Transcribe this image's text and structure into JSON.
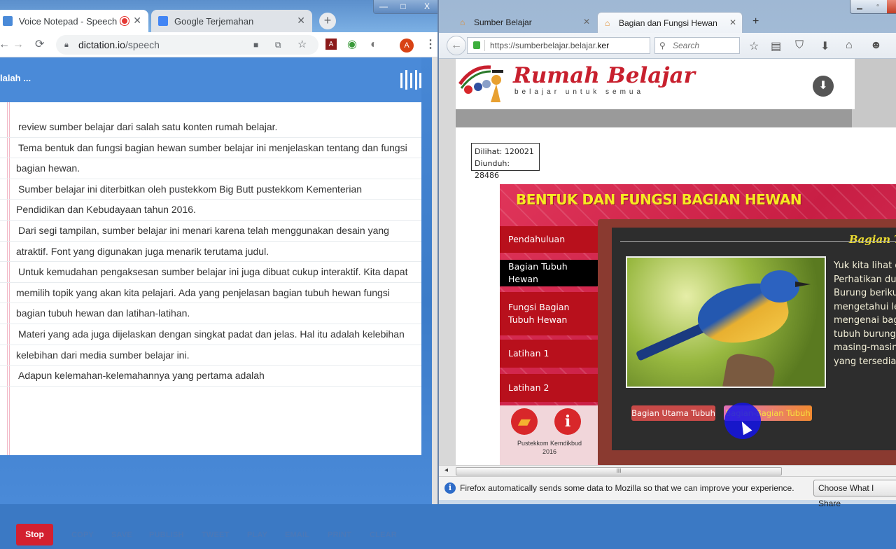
{
  "chrome": {
    "tabs": [
      {
        "label": "Voice Notepad - Speech to",
        "active": true,
        "recording": true
      },
      {
        "label": "Google Terjemahan",
        "active": false
      }
    ],
    "new_tab_label": "+",
    "window_controls": {
      "minimize": "—",
      "maximize": "□",
      "close": "X"
    },
    "address": {
      "domain": "dictation.io",
      "path": "/speech"
    },
    "profile_initial": "A",
    "icons": [
      "back-icon",
      "forward-icon",
      "reload-icon",
      "lock-icon",
      "camera-icon",
      "translate-icon",
      "star-icon",
      "pdf-extension-icon",
      "globe-extension-icon",
      "circle-extension-icon",
      "menu-icon"
    ]
  },
  "dictation": {
    "header_text": "lalah ...",
    "lines": [
      {
        "text": "review sumber belajar dari salah satu konten rumah belajar.",
        "indent": true
      },
      {
        "text": "Tema bentuk dan fungsi bagian hewan sumber belajar ini menjelaskan tentang dan fungsi",
        "indent": true
      },
      {
        "text": "bagian hewan.",
        "indent": false
      },
      {
        "text": "Sumber belajar ini diterbitkan oleh pustekkom Big Butt pustekkom Kementerian",
        "indent": true
      },
      {
        "text": "Pendidikan dan Kebudayaan tahun 2016.",
        "indent": false
      },
      {
        "text": "Dari segi tampilan,  sumber belajar ini menari karena telah menggunakan desain yang",
        "indent": true
      },
      {
        "text": "atraktif.  Font yang digunakan juga menarik terutama judul.",
        "indent": false
      },
      {
        "text": "Untuk kemudahan pengaksesan sumber belajar ini juga dibuat cukup interaktif.  Kita dapat",
        "indent": true
      },
      {
        "text": "memilih topik yang akan kita pelajari.  Ada yang penjelasan bagian tubuh hewan fungsi",
        "indent": false
      },
      {
        "text": "bagian tubuh hewan dan latihan-latihan.",
        "indent": false
      },
      {
        "text": "Materi yang ada juga dijelaskan dengan singkat padat dan jelas.  Hal itu adalah kelebihan",
        "indent": true
      },
      {
        "text": "kelebihan dari media sumber belajar ini.",
        "indent": false
      },
      {
        "text": "Adapun kelemahan-kelemahannya yang pertama adalah",
        "indent": true
      }
    ],
    "stop_label": "Stop",
    "actions": [
      "COPY",
      "SAVE",
      "PUBLISH",
      "TWEET",
      "PLAY",
      "EMAIL",
      "PRINT",
      "CLEAR"
    ],
    "accent_color": "#4a8ad8",
    "stop_color": "#d32030"
  },
  "firefox": {
    "tabs": [
      {
        "label": "Sumber Belajar",
        "active": false
      },
      {
        "label": "Bagian dan Fungsi Hewan",
        "active": true
      }
    ],
    "new_tab_label": "+",
    "url_prefix": "https://sumberbelajar.belajar.",
    "url_domain_tail": "ker",
    "search_placeholder": "Search",
    "toolbar_icons": [
      "bookmark-star-icon",
      "reading-list-icon",
      "pocket-icon",
      "download-icon",
      "home-icon",
      "chat-icon"
    ],
    "notice_text": "Firefox automatically sends some data to Mozilla so that we can improve your experience.",
    "notice_button": "Choose What I Share",
    "scroll_grip": "III"
  },
  "rumah_belajar": {
    "title": "Rumah Belajar",
    "tagline": "belajar untuk semua",
    "stats": {
      "viewed_label": "Dilihat: 120021",
      "downloaded_label": "Diunduh: 28486"
    },
    "module": {
      "title": "BENTUK DAN FUNGSI BAGIAN HEWAN",
      "menu": [
        {
          "label": "Pendahuluan",
          "active": false
        },
        {
          "label": "Bagian Tubuh Hewan",
          "active": true
        },
        {
          "label": "Fungsi Bagian Tubuh Hewan",
          "active": false
        },
        {
          "label": "Latihan 1",
          "active": false
        },
        {
          "label": "Latihan 2",
          "active": false
        }
      ],
      "credit_line1": "Pustekkom Kemdikbud",
      "credit_line2": "2016",
      "board_heading": "Bagian Tu",
      "description_lines": [
        "Yuk kita lihat d",
        "Perhatikan dul",
        "Burung beriku",
        "mengetahui le",
        "mengenai bag",
        "tubuh burung,",
        "masing-masing",
        "yang tersedia!"
      ],
      "buttons": [
        "Bagian Utama Tubuh",
        "Bagian-Bagian Tubuh"
      ],
      "title_color": "#f7ea22"
    }
  }
}
